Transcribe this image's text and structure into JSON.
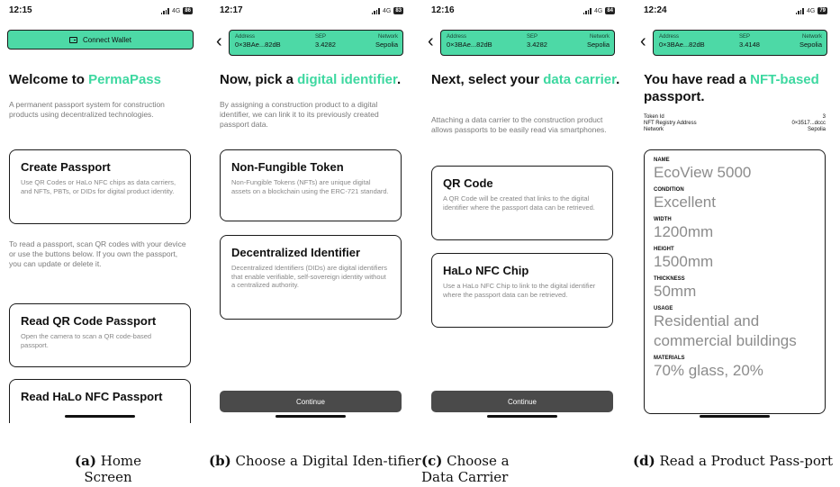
{
  "screens": [
    {
      "time": "12:15",
      "network": "4G",
      "battery": "86",
      "connect_wallet": "Connect Wallet",
      "title_prefix": "Welcome to ",
      "title_highlight": "PermaPass",
      "intro": "A permanent passport system for construction products using decentralized technologies.",
      "create_title": "Create Passport",
      "create_desc": "Use QR Codes or HaLo NFC chips as data carriers, and NFTs, PBTs, or DIDs for digital product identity.",
      "read_info": "To read a passport, scan QR codes with your device or use the buttons below. If you own the passport, you can update or delete it.",
      "read_qr_title": "Read QR Code Passport",
      "read_qr_desc": "Open the camera to scan a QR code-based passport.",
      "read_nfc_title": "Read HaLo NFC Passport",
      "caption_letter": "(a)",
      "caption_text": "Home Screen"
    },
    {
      "time": "12:17",
      "network": "4G",
      "battery": "83",
      "address_label": "Address",
      "address_value": "0×3BAe...82dB",
      "sep_label": "SEP",
      "sep_value": "3.4282",
      "network_label": "Network",
      "network_value": "Sepolia",
      "title_prefix": "Now, pick a ",
      "title_highlight": "digital identifier",
      "title_suffix": ".",
      "intro": "By assigning a construction product to a digital identifier, we can link it to its previously created passport data.",
      "option1_title": "Non-Fungible Token",
      "option1_desc": "Non-Fungible Tokens (NFTs) are unique digital assets on a blockchain using the ERC-721 standard.",
      "option2_title": "Decentralized Identifier",
      "option2_desc": "Decentralized Identifiers (DIDs) are digital identifiers that enable verifiable, self-sovereign identity without a centralized authority.",
      "continue": "Continue",
      "caption_letter": "(b)",
      "caption_text": "Choose a Digital Iden-tifier"
    },
    {
      "time": "12:16",
      "network": "4G",
      "battery": "84",
      "address_label": "Address",
      "address_value": "0×3BAe...82dB",
      "sep_label": "SEP",
      "sep_value": "3.4282",
      "network_label": "Network",
      "network_value": "Sepolia",
      "title_prefix": "Next, select your ",
      "title_highlight": "data carrier",
      "title_suffix": ".",
      "intro": "Attaching a data carrier to the construction product allows passports to be easily read via smartphones.",
      "option1_title": "QR Code",
      "option1_desc": "A QR Code will be created that links to the digital identifier where the passport data can be retrieved.",
      "option2_title": "HaLo NFC Chip",
      "option2_desc": "Use a HaLo NFC Chip to link to the digital identifier where the passport data can be retrieved.",
      "continue": "Continue",
      "caption_letter": "(c)",
      "caption_text": "Choose a Data Carrier"
    },
    {
      "time": "12:24",
      "network": "4G",
      "battery": "79",
      "address_label": "Address",
      "address_value": "0×3BAe...82dB",
      "sep_label": "SEP",
      "sep_value": "3.4148",
      "network_label": "Network",
      "network_value": "Sepolia",
      "title_prefix": "You have read a ",
      "title_highlight": "NFT-based",
      "title_suffix": " passport.",
      "token_id_label": "Token Id",
      "token_id_value": "3",
      "registry_label": "NFT Registry Address",
      "registry_value": "0×3517...dccc",
      "meta_network_label": "Network",
      "meta_network_value": "Sepolia",
      "fields": [
        {
          "label": "NAME",
          "value": "EcoView 5000"
        },
        {
          "label": "CONDITION",
          "value": "Excellent"
        },
        {
          "label": "WIDTH",
          "value": "1200mm"
        },
        {
          "label": "HEIGHT",
          "value": "1500mm"
        },
        {
          "label": "THICKNESS",
          "value": "50mm"
        },
        {
          "label": "USAGE",
          "value": "Residential and commercial buildings"
        },
        {
          "label": "MATERIALS",
          "value": "70% glass, 20%"
        }
      ],
      "caption_letter": "(d)",
      "caption_text": "Read a Product Pass-port"
    }
  ]
}
